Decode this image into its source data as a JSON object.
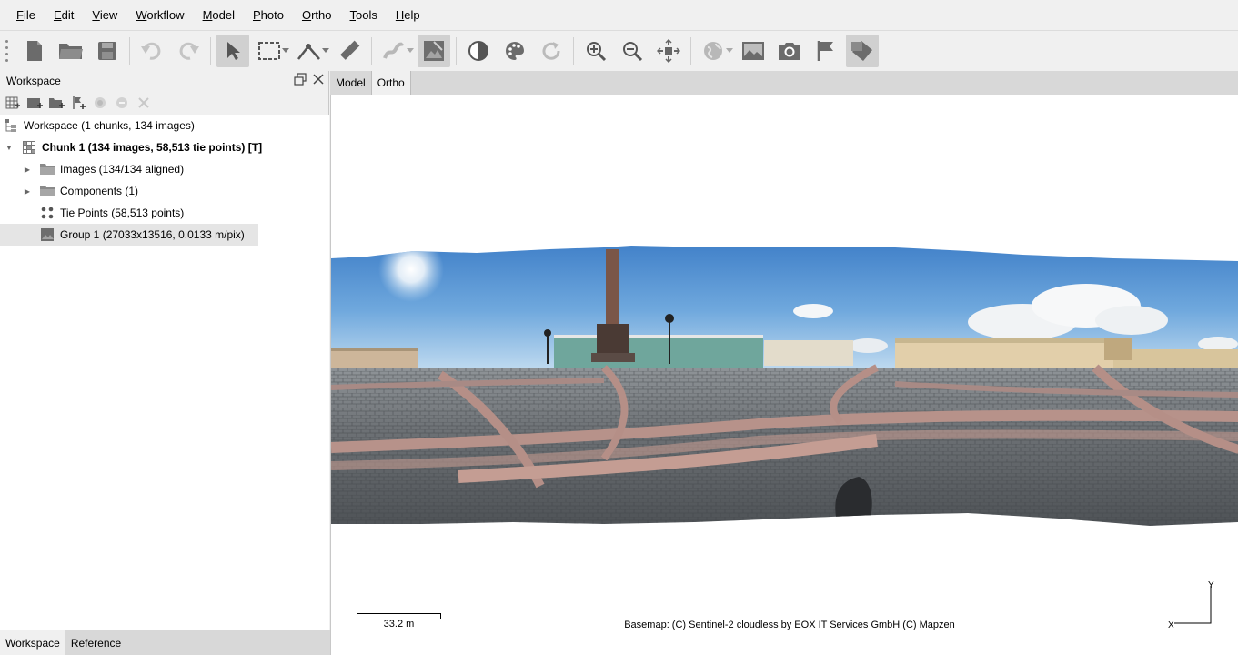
{
  "menu": {
    "items": [
      {
        "label": "File",
        "key": "F",
        "rest": "ile"
      },
      {
        "label": "Edit",
        "key": "E",
        "rest": "dit"
      },
      {
        "label": "View",
        "key": "V",
        "rest": "iew"
      },
      {
        "label": "Workflow",
        "key": "W",
        "rest": "orkflow"
      },
      {
        "label": "Model",
        "key": "M",
        "rest": "odel"
      },
      {
        "label": "Photo",
        "key": "P",
        "rest": "hoto"
      },
      {
        "label": "Ortho",
        "key": "O",
        "rest": "rtho"
      },
      {
        "label": "Tools",
        "key": "T",
        "rest": "ools"
      },
      {
        "label": "Help",
        "key": "H",
        "rest": "elp"
      }
    ]
  },
  "toolbar": {
    "icons": [
      "new-document-icon",
      "open-folder-icon",
      "save-icon",
      "undo-icon",
      "redo-icon",
      "navigation-arrow-icon",
      "rectangle-selection-icon",
      "ruler-line-icon",
      "ruler-icon",
      "draw-polyline-icon",
      "ortho-patch-icon",
      "brightness-icon",
      "palette-icon",
      "refresh-icon",
      "zoom-in-icon",
      "zoom-out-icon",
      "reset-view-icon",
      "globe-icon",
      "image-view-icon",
      "camera-icon",
      "flag-icon",
      "shapes-icon"
    ]
  },
  "workspace_panel": {
    "title": "Workspace",
    "tree": {
      "root": "Workspace (1 chunks, 134 images)",
      "chunk": "Chunk 1 (134 images, 58,513 tie points) [T]",
      "images": "Images (134/134 aligned)",
      "components": "Components (1)",
      "tie_points": "Tie Points (58,513 points)",
      "group": "Group 1 (27033x13516, 0.0133 m/pix)"
    }
  },
  "bottom_tabs": {
    "workspace": "Workspace",
    "reference": "Reference"
  },
  "view_tabs": {
    "model": "Model",
    "ortho": "Ortho"
  },
  "viewport": {
    "scale_label": "33.2 m",
    "basemap_credit": "Basemap: (C) Sentinel-2 cloudless by EOX IT Services GmbH (C) Mapzen",
    "axis_y": "Y",
    "axis_x": "X"
  },
  "colors": {
    "accent_selection": "#e5e5e5",
    "toolbar_bg": "#f0f0f0"
  }
}
